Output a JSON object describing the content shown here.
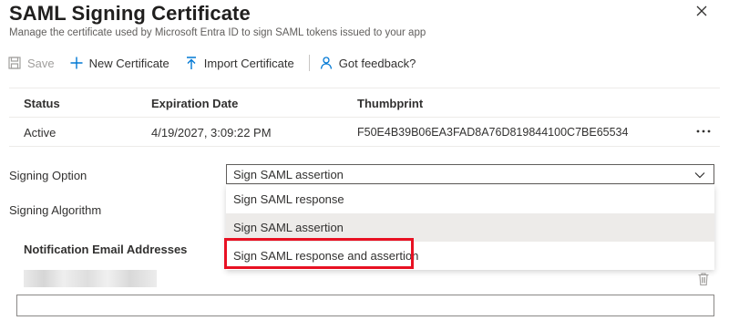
{
  "header": {
    "title": "SAML Signing Certificate",
    "subtitle": "Manage the certificate used by Microsoft Entra ID to sign SAML tokens issued to your app"
  },
  "toolbar": {
    "save_label": "Save",
    "new_certificate_label": "New Certificate",
    "import_certificate_label": "Import Certificate",
    "feedback_label": "Got feedback?"
  },
  "table": {
    "columns": [
      "Status",
      "Expiration Date",
      "Thumbprint"
    ],
    "rows": [
      {
        "status": "Active",
        "expiration": "4/19/2027, 3:09:22 PM",
        "thumbprint": "F50E4B39B06EA3FAD8A76D819844100C7BE65534"
      }
    ]
  },
  "signing_option": {
    "label": "Signing Option",
    "selected_value": "Sign SAML assertion",
    "options": [
      "Sign SAML response",
      "Sign SAML assertion",
      "Sign SAML response and assertion"
    ]
  },
  "signing_algorithm": {
    "label": "Signing Algorithm"
  },
  "notification": {
    "label": "Notification Email Addresses",
    "input_value": ""
  },
  "colors": {
    "highlight": "#e81123",
    "accent": "#0078d4"
  }
}
